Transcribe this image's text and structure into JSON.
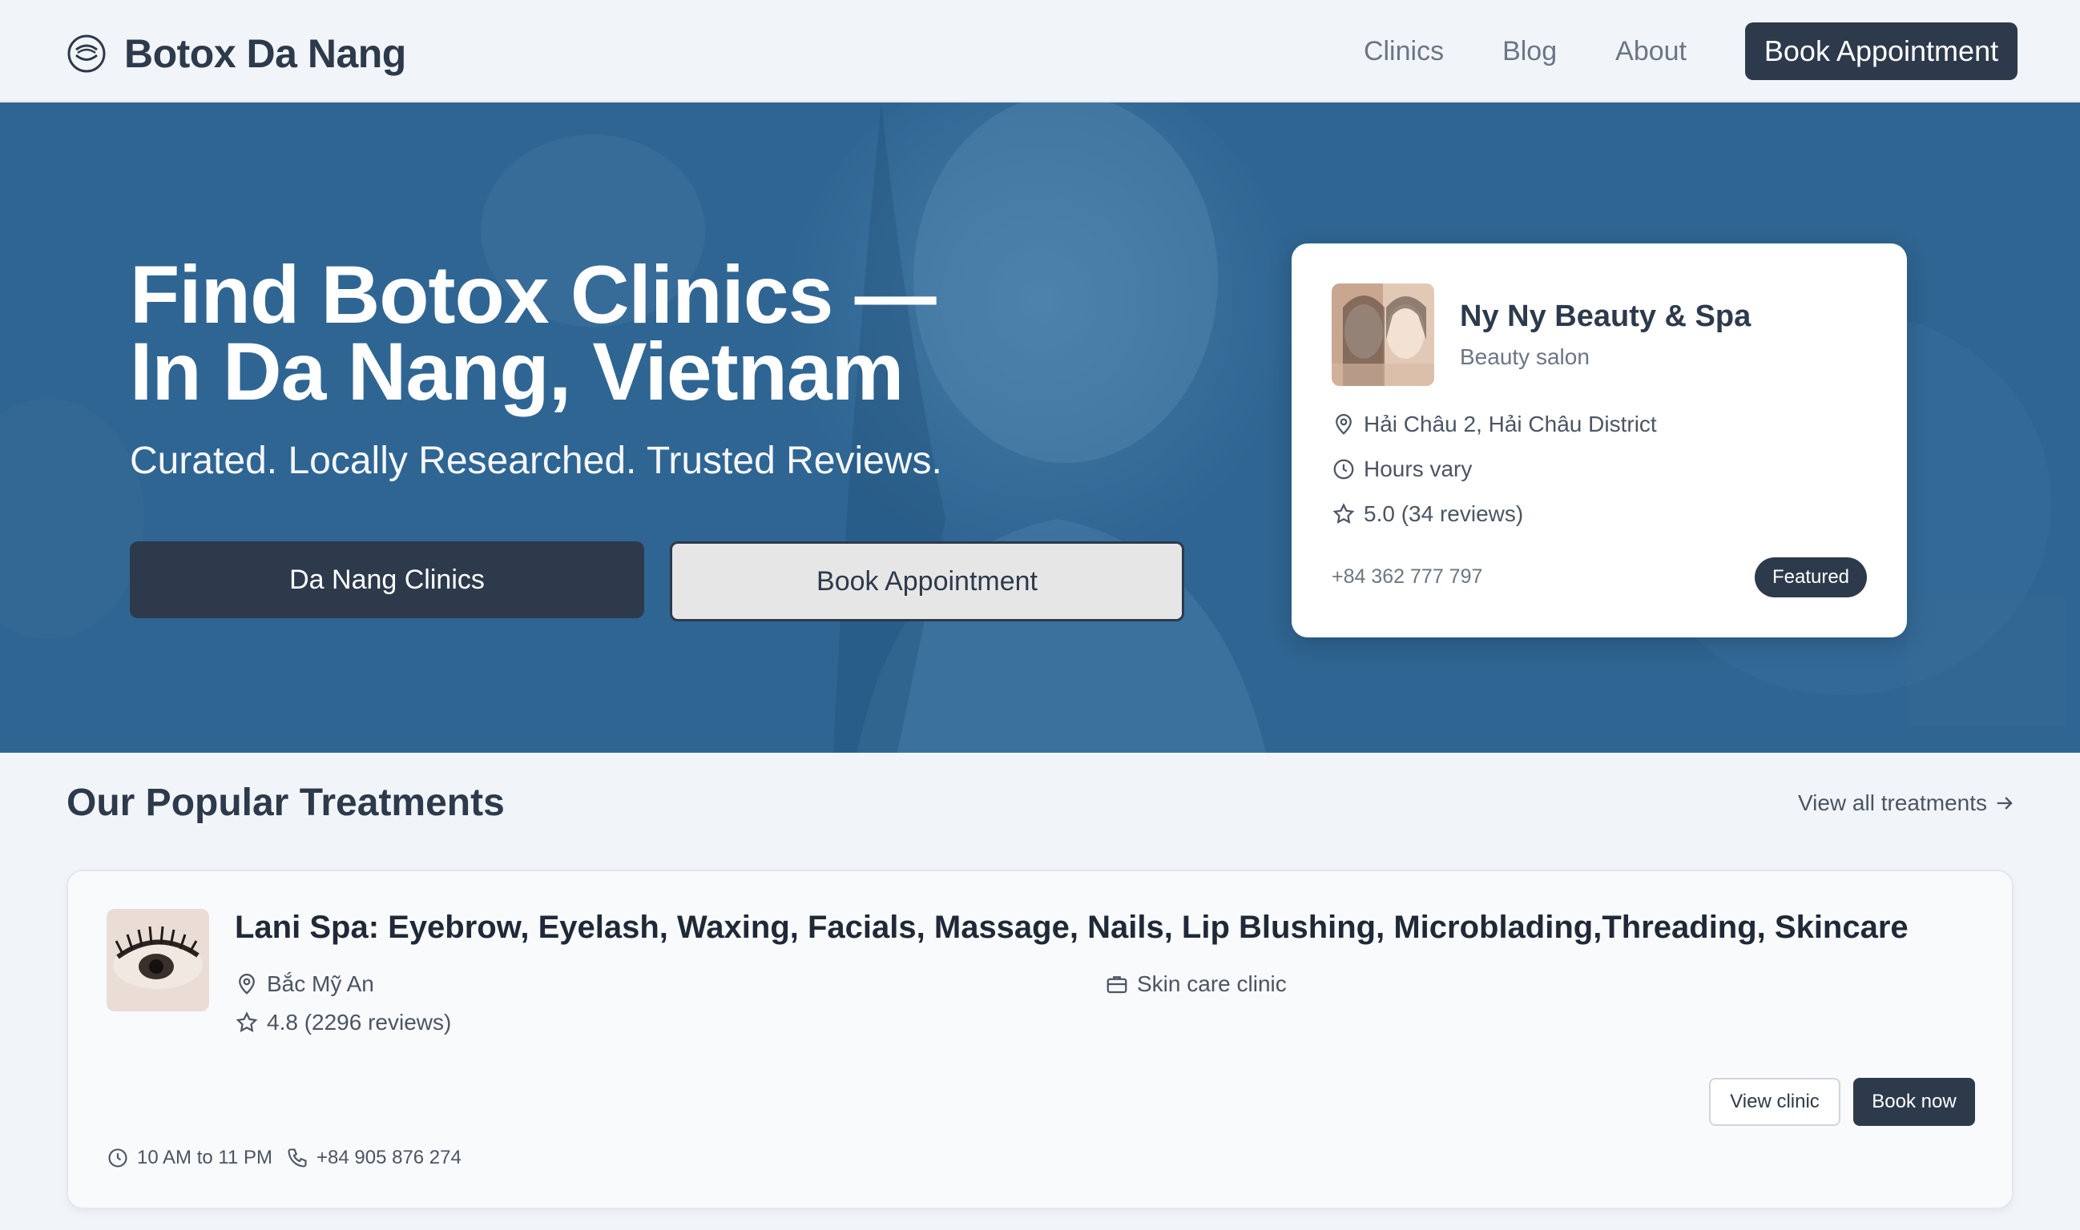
{
  "header": {
    "brand": "Botox Da Nang",
    "nav": [
      "Clinics",
      "Blog",
      "About"
    ],
    "cta": "Book Appointment"
  },
  "hero": {
    "title_line1": "Find Botox Clinics —",
    "title_line2": "In Da Nang, Vietnam",
    "subtitle": "Curated. Locally Researched. Trusted Reviews.",
    "primary_button": "Da Nang Clinics",
    "secondary_button": "Book Appointment"
  },
  "featured": {
    "name": "Ny Ny Beauty & Spa",
    "type": "Beauty salon",
    "address": "Hải Châu 2, Hải Châu District",
    "hours": "Hours vary",
    "rating": "5.0 (34 reviews)",
    "phone": "+84 362 777 797",
    "badge": "Featured"
  },
  "section": {
    "title": "Our Popular Treatments",
    "link": "View all treatments"
  },
  "listing": {
    "title": "Lani Spa: Eyebrow, Eyelash, Waxing, Facials, Massage, Nails, Lip Blushing, Microblading,Threading, Skincare",
    "location": "Bắc Mỹ An",
    "category": "Skin care clinic",
    "rating": "4.8 (2296 reviews)",
    "view_button": "View clinic",
    "book_button": "Book now",
    "hours": "10 AM to 11 PM",
    "phone": "+84 905 876 274"
  },
  "colors": {
    "primary": "#2d3a4b",
    "hero_overlay": "#2f6592",
    "page_bg": "#f1f5f9"
  }
}
